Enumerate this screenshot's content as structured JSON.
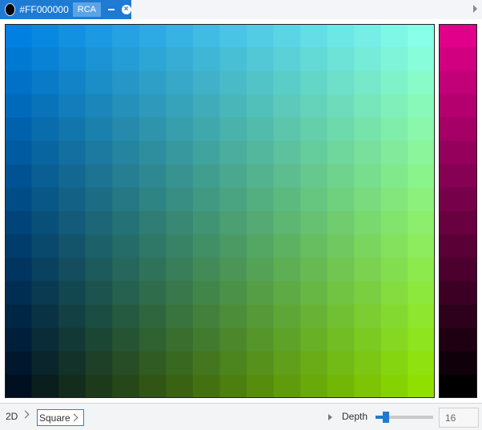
{
  "tab": {
    "swatch_color": "#000000",
    "title": "#FF000000",
    "badge": "RCA",
    "minimize_icon": "minus-icon",
    "close_icon": "close-icon",
    "accent": "#1e7ad2"
  },
  "picker": {
    "grid_size": 16,
    "top_left": "#0080e0",
    "top_right": "#88ffe8",
    "bottom_left": "#001020",
    "bottom_right": "#8fe000",
    "strip_top": "#e0008a",
    "strip_bottom": "#000000"
  },
  "toolbar": {
    "mode_label": "2D",
    "shape_label": "Square",
    "depth_label": "Depth",
    "depth_value": "16",
    "depth_slider_fraction": 0.14
  }
}
